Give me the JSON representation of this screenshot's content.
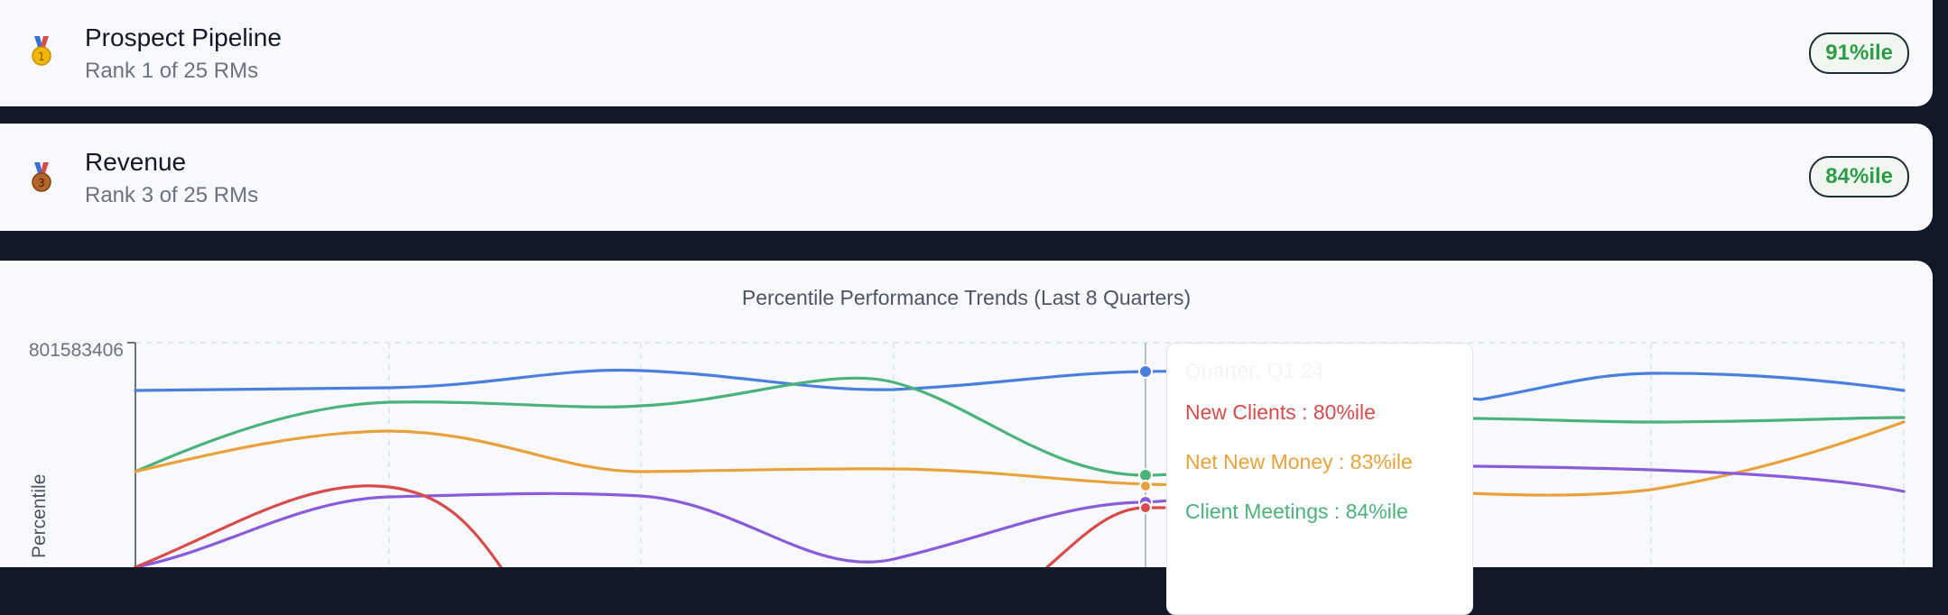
{
  "rankings": [
    {
      "medal": "gold-medal",
      "medal_number": "1",
      "title": "Prospect Pipeline",
      "subtitle": "Rank 1 of 25 RMs",
      "badge": "91%ile"
    },
    {
      "medal": "bronze-medal",
      "medal_number": "3",
      "title": "Revenue",
      "subtitle": "Rank 3 of 25 RMs",
      "badge": "84%ile"
    }
  ],
  "chart": {
    "title": "Percentile Performance Trends (Last 8 Quarters)",
    "y_axis_label": "Percentile",
    "y_top_tick": "801583406",
    "tooltip": {
      "header": "Quarter: Q1 24",
      "lines": [
        {
          "text": "New Clients : 80%ile",
          "color": "#d94a4a"
        },
        {
          "text": "Net New Money : 83%ile",
          "color": "#e9a23b"
        },
        {
          "text": "Client Meetings : 84%ile",
          "color": "#4bb27b"
        }
      ]
    },
    "colors": {
      "blue": "#4a7fe0",
      "green": "#4bb27b",
      "orange": "#e9a23b",
      "purple": "#8a5cdc",
      "red": "#d94a4a",
      "badge_green": "#2e9b46"
    }
  }
}
